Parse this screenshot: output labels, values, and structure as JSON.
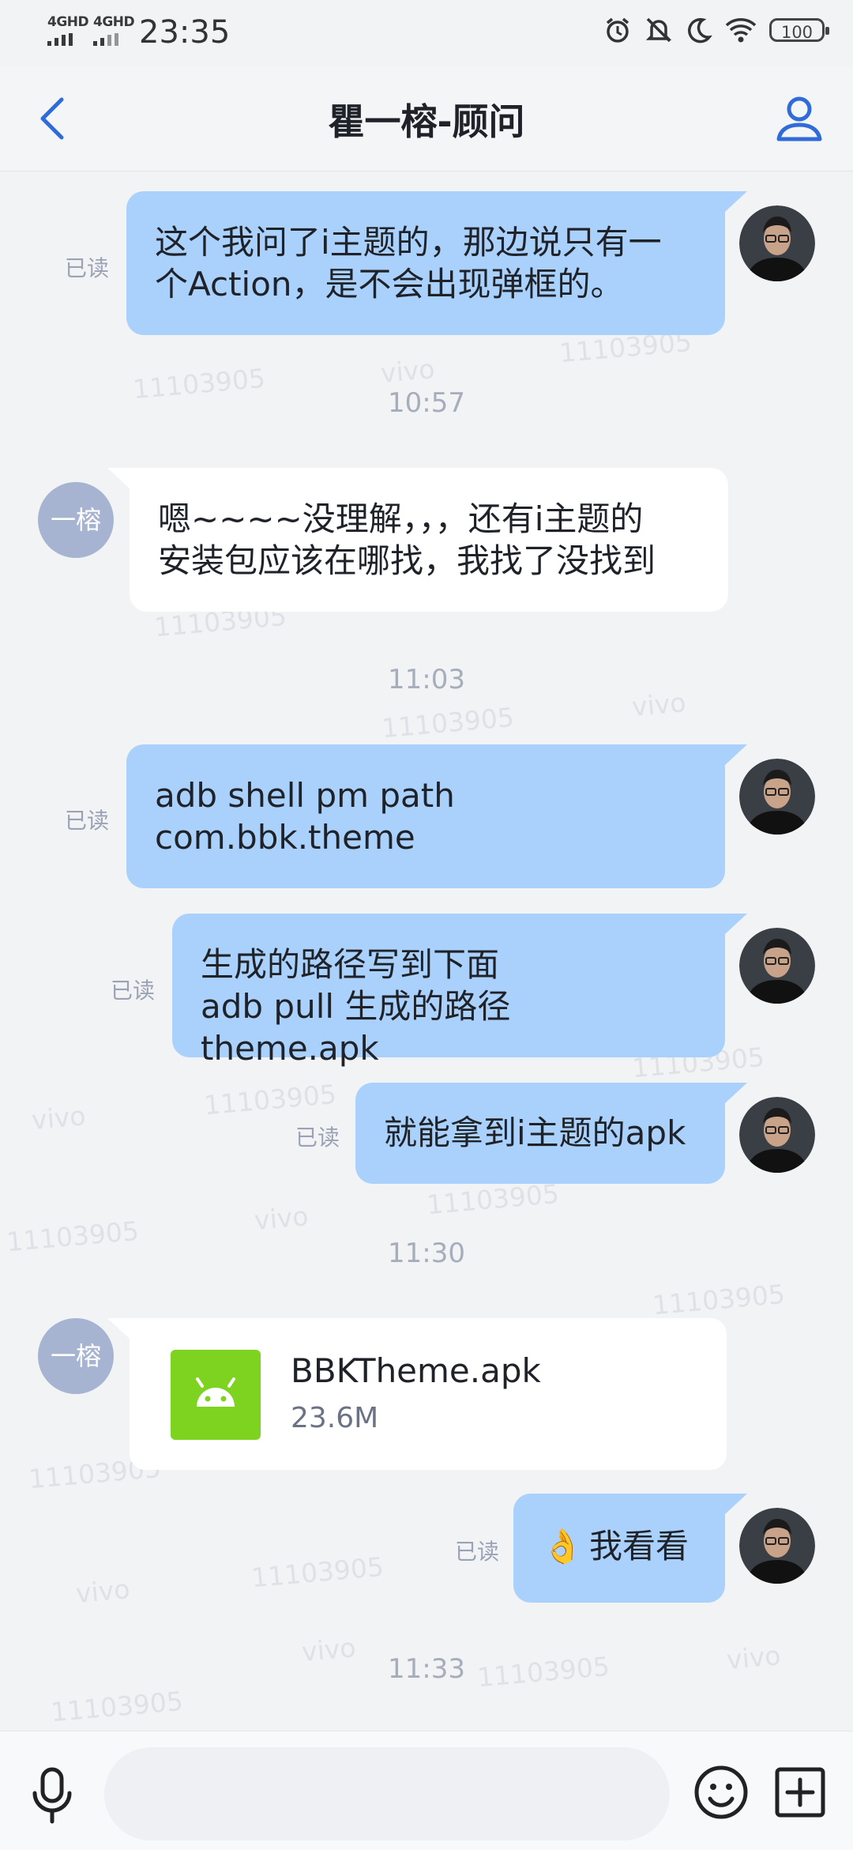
{
  "status_bar": {
    "network_1": "4GHD",
    "network_2": "4GHD",
    "time": "23:35",
    "battery": "100",
    "icons": [
      "alarm-icon",
      "mute-bell-icon",
      "do-not-disturb-moon-icon",
      "wifi-icon"
    ]
  },
  "nav": {
    "title": "瞿一榕-顾问",
    "back_icon": "chevron-left-icon",
    "contact_icon": "contact-person-icon",
    "accent_color": "#2f6bd9"
  },
  "watermark": {
    "id_text": "11103905",
    "brand_text": "vivo"
  },
  "read_label": "已读",
  "other_avatar_text": "一榕",
  "messages": [
    {
      "dir": "out",
      "lines": [
        "这个我问了i主题的，那边说只有一",
        "个Action，是不会出现弹框的。"
      ]
    },
    {
      "type": "time",
      "text": "10:57"
    },
    {
      "dir": "in",
      "lines": [
        "嗯~~~~没理解，，，还有i主题的",
        "安装包应该在哪找，我找了没找到"
      ]
    },
    {
      "type": "time",
      "text": "11:03"
    },
    {
      "dir": "out",
      "lines": [
        "adb shell pm path",
        "com.bbk.theme"
      ]
    },
    {
      "dir": "out",
      "lines": [
        "生成的路径写到下面",
        "adb pull 生成的路径 theme.apk"
      ]
    },
    {
      "dir": "out",
      "lines": [
        "就能拿到i主题的apk"
      ]
    },
    {
      "type": "time",
      "text": "11:30"
    },
    {
      "dir": "in",
      "type": "file",
      "file_name": "BBKTheme.apk",
      "file_size": "23.6M",
      "file_icon": "android-icon"
    },
    {
      "dir": "out",
      "emoji": "👌",
      "lines": [
        "我看看"
      ]
    },
    {
      "type": "time",
      "text": "11:33"
    }
  ],
  "input": {
    "placeholder": "",
    "value": ""
  },
  "bottom_icons": {
    "mic": "microphone-icon",
    "emoji": "smiley-icon",
    "plus": "plus-square-icon"
  },
  "colors": {
    "outgoing_bubble": "#a9d1fb",
    "incoming_bubble": "#ffffff",
    "file_icon_bg": "#7ed321"
  }
}
